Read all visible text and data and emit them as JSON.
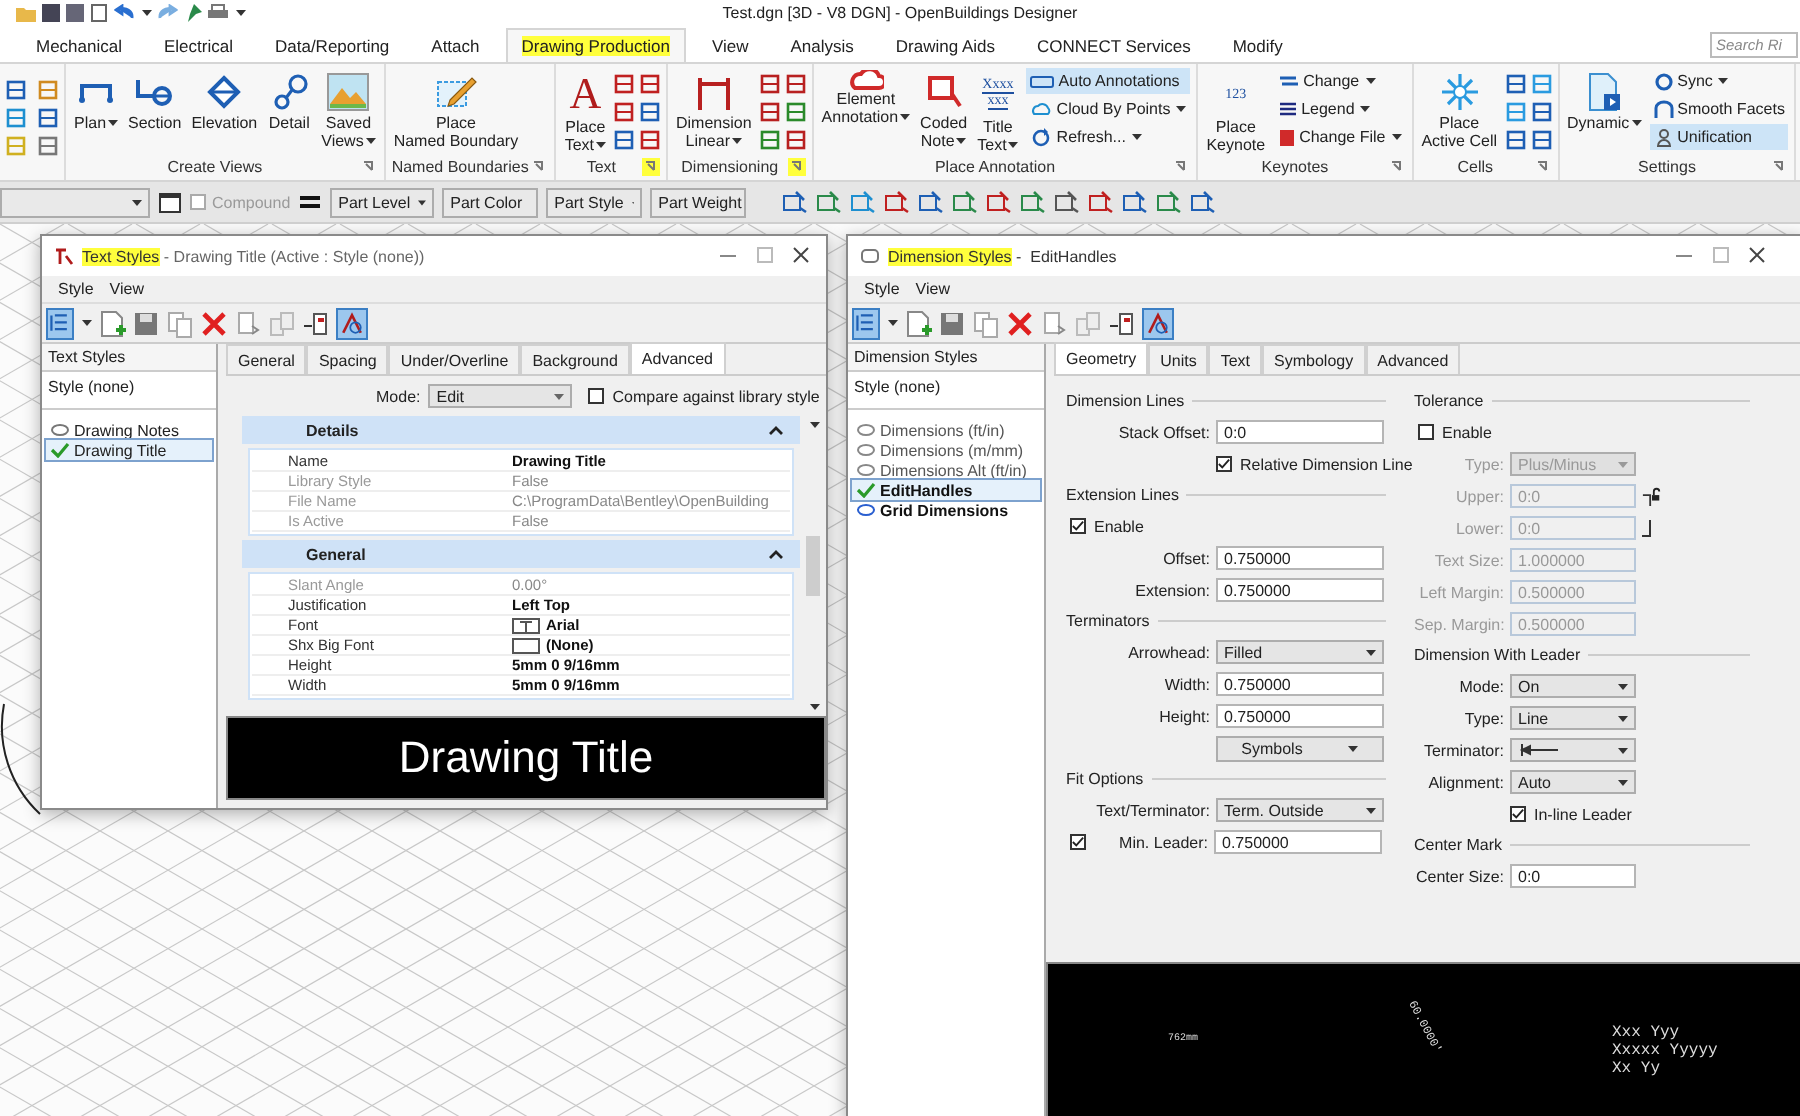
{
  "app": {
    "title": "Test.dgn [3D - V8 DGN] - OpenBuildings Designer"
  },
  "ribbon_tabs": [
    {
      "label": "Mechanical",
      "selected": false,
      "highlighted": false
    },
    {
      "label": "Electrical",
      "selected": false,
      "highlighted": false
    },
    {
      "label": "Data/Reporting",
      "selected": false,
      "highlighted": false
    },
    {
      "label": "Attach",
      "selected": false,
      "highlighted": false
    },
    {
      "label": "Drawing Production",
      "selected": true,
      "highlighted": true
    },
    {
      "label": "View",
      "selected": false,
      "highlighted": false
    },
    {
      "label": "Analysis",
      "selected": false,
      "highlighted": false
    },
    {
      "label": "Drawing Aids",
      "selected": false,
      "highlighted": false
    },
    {
      "label": "CONNECT Services",
      "selected": false,
      "highlighted": false
    },
    {
      "label": "Modify",
      "selected": false,
      "highlighted": false
    }
  ],
  "search": {
    "placeholder": "Search Ri"
  },
  "ribbon_groups": [
    {
      "label": "Create Views",
      "launcher_highlighted": false,
      "buttons": [
        {
          "kind": "large",
          "label": [
            "Plan"
          ],
          "dropdown": true,
          "selected": false
        },
        {
          "kind": "large",
          "label": [
            "Section"
          ],
          "dropdown": false,
          "selected": false
        },
        {
          "kind": "large",
          "label": [
            "Elevation"
          ],
          "dropdown": false,
          "selected": false
        },
        {
          "kind": "large",
          "label": [
            "Detail"
          ],
          "dropdown": false,
          "selected": false
        },
        {
          "kind": "large",
          "label": [
            "Saved",
            "Views"
          ],
          "dropdown": true,
          "selected": false
        }
      ]
    },
    {
      "label": "Named Boundaries",
      "launcher_highlighted": false,
      "buttons": [
        {
          "kind": "large",
          "label": [
            "Place",
            "Named Boundary"
          ],
          "dropdown": false,
          "selected": false
        }
      ]
    },
    {
      "label": "Text",
      "launcher_highlighted": true,
      "buttons": [
        {
          "kind": "large",
          "label": [
            "Place",
            "Text"
          ],
          "glyph": [
            "A"
          ],
          "dropdown": true,
          "selected": false
        },
        {
          "kind": "tools"
        }
      ]
    },
    {
      "label": "Dimensioning",
      "launcher_highlighted": true,
      "buttons": [
        {
          "kind": "large",
          "label": [
            "Dimension",
            "Linear"
          ],
          "dropdown": true,
          "selected": false
        },
        {
          "kind": "tools"
        }
      ]
    },
    {
      "label": "Place Annotation",
      "launcher_highlighted": false,
      "buttons": [
        {
          "kind": "large",
          "label": [
            "Element",
            "Annotation"
          ],
          "dropdown": true,
          "selected": false
        },
        {
          "kind": "large",
          "label": [
            "Coded",
            "Note"
          ],
          "dropdown": true,
          "selected": false
        },
        {
          "kind": "large",
          "label": [
            "Title",
            "Text"
          ],
          "glyph": [
            "Xxxx",
            "xxx"
          ],
          "dropdown": true,
          "selected": false
        },
        {
          "kind": "small",
          "label": [
            "Auto Annotations"
          ],
          "dropdown": false,
          "selected": true
        },
        {
          "kind": "small",
          "label": [
            "Cloud By Points"
          ],
          "dropdown": true,
          "selected": false
        },
        {
          "kind": "small",
          "label": [
            "Refresh..."
          ],
          "dropdown": true,
          "selected": false
        }
      ]
    },
    {
      "label": "Keynotes",
      "launcher_highlighted": false,
      "buttons": [
        {
          "kind": "large",
          "label": [
            "Place",
            "Keynote"
          ],
          "glyph": [
            "123"
          ],
          "dropdown": false,
          "selected": false
        },
        {
          "kind": "small",
          "label": [
            "Change"
          ],
          "dropdown": true,
          "selected": false
        },
        {
          "kind": "small",
          "label": [
            "Legend"
          ],
          "dropdown": true,
          "selected": false
        },
        {
          "kind": "small",
          "label": [
            "Change File"
          ],
          "dropdown": true,
          "selected": false
        }
      ]
    },
    {
      "label": "Cells",
      "launcher_highlighted": false,
      "buttons": [
        {
          "kind": "large",
          "label": [
            "Place",
            "Active Cell"
          ],
          "dropdown": false,
          "selected": false
        },
        {
          "kind": "tools"
        }
      ]
    },
    {
      "label": "Settings",
      "launcher_highlighted": false,
      "buttons": [
        {
          "kind": "large",
          "label": [
            "Dynamic"
          ],
          "dropdown": true,
          "selected": false
        },
        {
          "kind": "small",
          "label": [
            "Sync"
          ],
          "dropdown": true,
          "selected": false
        },
        {
          "kind": "small",
          "label": [
            "Smooth Facets"
          ],
          "dropdown": false,
          "selected": false
        },
        {
          "kind": "small",
          "label": [
            "Unification"
          ],
          "dropdown": false,
          "selected": true
        }
      ]
    }
  ],
  "attribute_bar": {
    "compound": {
      "label": "Compound",
      "checked": false,
      "disabled": true
    },
    "dropdowns": [
      "Part Level",
      "Part Color",
      "Part Style",
      "Part Weight"
    ]
  },
  "text_styles_dialog": {
    "title": [
      {
        "text": "Text Styles",
        "highlighted": true
      },
      {
        "text": " - Drawing Title (Active : Style (none))",
        "highlighted": false
      }
    ],
    "menu": [
      "Style",
      "View"
    ],
    "list_header": "Text Styles",
    "list_none": "Style (none)",
    "styles": [
      {
        "label": "Drawing Notes",
        "selected": false
      },
      {
        "label": "Drawing Title",
        "selected": true
      }
    ],
    "tabs": [
      {
        "label": "General",
        "selected": false
      },
      {
        "label": "Spacing",
        "selected": false
      },
      {
        "label": "Under/Overline",
        "selected": false
      },
      {
        "label": "Background",
        "selected": false
      },
      {
        "label": "Advanced",
        "selected": true
      }
    ],
    "mode": {
      "label": "Mode:",
      "value": "Edit"
    },
    "compare": {
      "label": "Compare against library style",
      "checked": false
    },
    "sections": [
      {
        "title": "Details",
        "expanded": true,
        "rows": [
          {
            "kind": "text",
            "name": "Name",
            "value": "Drawing Title",
            "disabled": false
          },
          {
            "kind": "text",
            "name": "Library Style",
            "value": "False",
            "disabled": true
          },
          {
            "kind": "text",
            "name": "File Name",
            "value": "C:\\ProgramData\\Bentley\\OpenBuilding",
            "disabled": true
          },
          {
            "kind": "text",
            "name": "Is Active",
            "value": "False",
            "disabled": true
          }
        ]
      },
      {
        "title": "General",
        "expanded": true,
        "rows": [
          {
            "kind": "text",
            "name": "Slant Angle",
            "value": "0.00°",
            "disabled": true
          },
          {
            "kind": "text",
            "name": "Justification",
            "value": "Left Top",
            "disabled": false
          },
          {
            "kind": "font",
            "name": "Font",
            "value": "Arial",
            "disabled": false
          },
          {
            "kind": "font",
            "name": "Shx Big Font",
            "value": "(None)",
            "disabled": false
          },
          {
            "kind": "text",
            "name": "Height",
            "value": "5mm 0 9/16mm",
            "disabled": false
          },
          {
            "kind": "text",
            "name": "Width",
            "value": "5mm 0 9/16mm",
            "disabled": false
          }
        ]
      }
    ],
    "preview": "Drawing Title"
  },
  "dimension_styles_dialog": {
    "title": [
      {
        "text": "Dimension Styles",
        "highlighted": true
      },
      {
        "text": " -  EditHandles",
        "highlighted": false
      }
    ],
    "menu": [
      "Style",
      "View"
    ],
    "list_header": "Dimension Styles",
    "list_none": "Style (none)",
    "styles": [
      {
        "label": "Dimensions (ft/in)",
        "selected": false,
        "in_use": false
      },
      {
        "label": "Dimensions (m/mm)",
        "selected": false,
        "in_use": false
      },
      {
        "label": "Dimensions Alt (ft/in)",
        "selected": false,
        "in_use": false
      },
      {
        "label": "EditHandles",
        "selected": true,
        "in_use": true
      },
      {
        "label": "Grid Dimensions",
        "selected": false,
        "in_use": true
      }
    ],
    "tabs": [
      {
        "label": "Geometry",
        "selected": true
      },
      {
        "label": "Units",
        "selected": false
      },
      {
        "label": "Text",
        "selected": false
      },
      {
        "label": "Symbology",
        "selected": false
      },
      {
        "label": "Advanced",
        "selected": false
      }
    ],
    "columns": [
      [
        {
          "title": "Dimension Lines",
          "fields": [
            {
              "kind": "input",
              "label": "Stack Offset:",
              "value": "0:0",
              "disabled": false
            },
            {
              "kind": "field_checkbox",
              "label": "Relative Dimension Line",
              "checked": true,
              "disabled": false
            }
          ]
        },
        {
          "title": "Extension Lines",
          "fields": [
            {
              "kind": "checkbox",
              "label": "Enable",
              "checked": true,
              "disabled": false
            },
            {
              "kind": "input",
              "label": "Offset:",
              "value": "0.750000",
              "disabled": false
            },
            {
              "kind": "input",
              "label": "Extension:",
              "value": "0.750000",
              "disabled": false
            }
          ]
        },
        {
          "title": "Terminators",
          "fields": [
            {
              "kind": "select",
              "label": "Arrowhead:",
              "value": "Filled",
              "disabled": false
            },
            {
              "kind": "input",
              "label": "Width:",
              "value": "0.750000",
              "disabled": false
            },
            {
              "kind": "input",
              "label": "Height:",
              "value": "0.750000",
              "disabled": false
            },
            {
              "kind": "menu_button",
              "value": "Symbols"
            }
          ]
        },
        {
          "title": "Fit Options",
          "fields": [
            {
              "kind": "select",
              "label": "Text/Terminator:",
              "value": "Term. Outside",
              "disabled": false
            },
            {
              "kind": "checked_input",
              "label": "Min. Leader:",
              "value": "0.750000",
              "checked": true,
              "disabled": false
            }
          ]
        }
      ],
      [
        {
          "title": "Tolerance",
          "fields": [
            {
              "kind": "checkbox",
              "label": "Enable",
              "checked": false,
              "disabled": false
            },
            {
              "kind": "select",
              "label": "Type:",
              "value": "Plus/Minus",
              "disabled": true
            },
            {
              "kind": "linked_top",
              "label": "Upper:",
              "value": "0:0",
              "disabled": true
            },
            {
              "kind": "linked_bottom",
              "label": "Lower:",
              "value": "0:0",
              "disabled": true
            },
            {
              "kind": "input",
              "label": "Text Size:",
              "value": "1.000000",
              "disabled": true
            },
            {
              "kind": "input",
              "label": "Left Margin:",
              "value": "0.500000",
              "disabled": true
            },
            {
              "kind": "input",
              "label": "Sep. Margin:",
              "value": "0.500000",
              "disabled": true
            }
          ]
        },
        {
          "title": "Dimension With Leader",
          "fields": [
            {
              "kind": "select",
              "label": "Mode:",
              "value": "On",
              "disabled": false
            },
            {
              "kind": "select",
              "label": "Type:",
              "value": "Line",
              "disabled": false
            },
            {
              "kind": "select_icon",
              "label": "Terminator:"
            },
            {
              "kind": "select",
              "label": "Alignment:",
              "value": "Auto",
              "disabled": false
            },
            {
              "kind": "field_checkbox",
              "label": "In-line Leader",
              "checked": true,
              "disabled": false
            }
          ]
        },
        {
          "title": "Center Mark",
          "fields": [
            {
              "kind": "input",
              "label": "Center Size:",
              "value": "0:0",
              "disabled": false
            }
          ]
        }
      ]
    ],
    "preview": {
      "dimension": "762mm",
      "angle": "60.0000'",
      "note_lines": [
        "Xxx Yyy",
        "Xxxxx Yyyyy",
        "Xx Yy"
      ]
    }
  }
}
